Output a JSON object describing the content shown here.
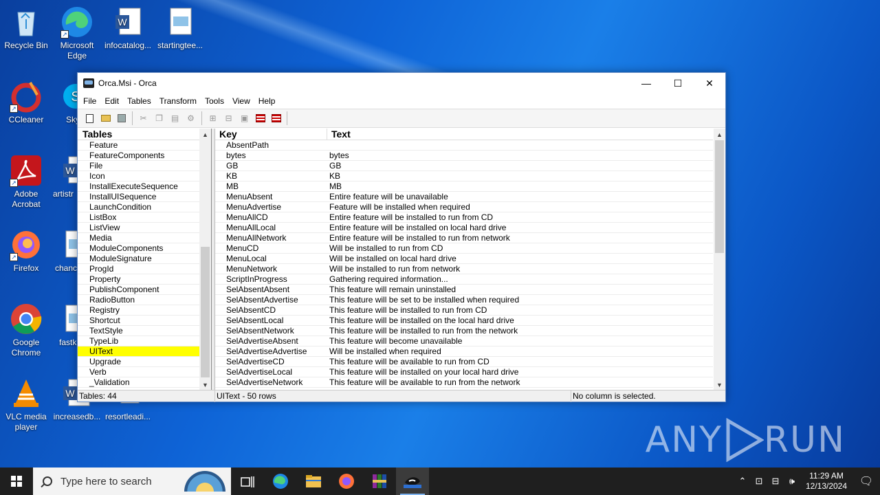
{
  "desktop_icons": [
    {
      "label": "Recycle Bin"
    },
    {
      "label": "Microsoft Edge"
    },
    {
      "label": "infocatalog..."
    },
    {
      "label": "startingtee..."
    },
    {
      "label": "CCleaner"
    },
    {
      "label": "Sky"
    },
    {
      "label": "Adobe Acrobat"
    },
    {
      "label": "artistr"
    },
    {
      "label": "Firefox"
    },
    {
      "label": "chanc"
    },
    {
      "label": "Google Chrome"
    },
    {
      "label": "fastk"
    },
    {
      "label": "VLC media player"
    },
    {
      "label": "increasedb..."
    },
    {
      "label": "resortleadi..."
    }
  ],
  "watermark": {
    "left": "ANY",
    "right": "RUN"
  },
  "window": {
    "title": "Orca.Msi - Orca",
    "controls": {
      "minimize": "—",
      "maximize": "☐",
      "close": "✕"
    },
    "menu": [
      "File",
      "Edit",
      "Tables",
      "Transform",
      "Tools",
      "View",
      "Help"
    ],
    "tables_header": "Tables",
    "tables": [
      "Feature",
      "FeatureComponents",
      "File",
      "Icon",
      "InstallExecuteSequence",
      "InstallUISequence",
      "LaunchCondition",
      "ListBox",
      "ListView",
      "Media",
      "ModuleComponents",
      "ModuleSignature",
      "ProgId",
      "Property",
      "PublishComponent",
      "RadioButton",
      "Registry",
      "Shortcut",
      "TextStyle",
      "TypeLib",
      "UIText",
      "Upgrade",
      "Verb",
      "_Validation"
    ],
    "selected_table": "UIText",
    "columns": {
      "key": "Key",
      "text": "Text"
    },
    "rows": [
      {
        "key": "AbsentPath",
        "text": ""
      },
      {
        "key": "bytes",
        "text": "bytes"
      },
      {
        "key": "GB",
        "text": "GB"
      },
      {
        "key": "KB",
        "text": "KB"
      },
      {
        "key": "MB",
        "text": "MB"
      },
      {
        "key": "MenuAbsent",
        "text": "Entire feature will be unavailable"
      },
      {
        "key": "MenuAdvertise",
        "text": "Feature will be installed when required"
      },
      {
        "key": "MenuAllCD",
        "text": "Entire feature will be installed to run from CD"
      },
      {
        "key": "MenuAllLocal",
        "text": "Entire feature will be installed on local hard drive"
      },
      {
        "key": "MenuAllNetwork",
        "text": "Entire feature will be installed to run from network"
      },
      {
        "key": "MenuCD",
        "text": "Will be installed to run from CD"
      },
      {
        "key": "MenuLocal",
        "text": "Will be installed on local hard drive"
      },
      {
        "key": "MenuNetwork",
        "text": "Will be installed to run from network"
      },
      {
        "key": "ScriptInProgress",
        "text": "Gathering required information..."
      },
      {
        "key": "SelAbsentAbsent",
        "text": "This feature will remain uninstalled"
      },
      {
        "key": "SelAbsentAdvertise",
        "text": "This feature will be set to be installed when required"
      },
      {
        "key": "SelAbsentCD",
        "text": "This feature will be installed to run from CD"
      },
      {
        "key": "SelAbsentLocal",
        "text": "This feature will be installed on the local hard drive"
      },
      {
        "key": "SelAbsentNetwork",
        "text": "This feature will be installed to run from the network"
      },
      {
        "key": "SelAdvertiseAbsent",
        "text": "This feature will become unavailable"
      },
      {
        "key": "SelAdvertiseAdvertise",
        "text": "Will be installed when required"
      },
      {
        "key": "SelAdvertiseCD",
        "text": "This feature will be available to run from CD"
      },
      {
        "key": "SelAdvertiseLocal",
        "text": "This feature will be installed on your local hard drive"
      },
      {
        "key": "SelAdvertiseNetwork",
        "text": "This feature will be available to run from the network"
      }
    ],
    "status": {
      "tables_count": "Tables: 44",
      "rows_info": "UIText - 50 rows",
      "column_info": "No column is selected."
    }
  },
  "taskbar": {
    "search_placeholder": "Type here to search",
    "time": "11:29 AM",
    "date": "12/13/2024"
  },
  "colors": {
    "selection": "#ffff00",
    "desktop": "#0e63d6",
    "taskbar": "#1f1f1f"
  }
}
